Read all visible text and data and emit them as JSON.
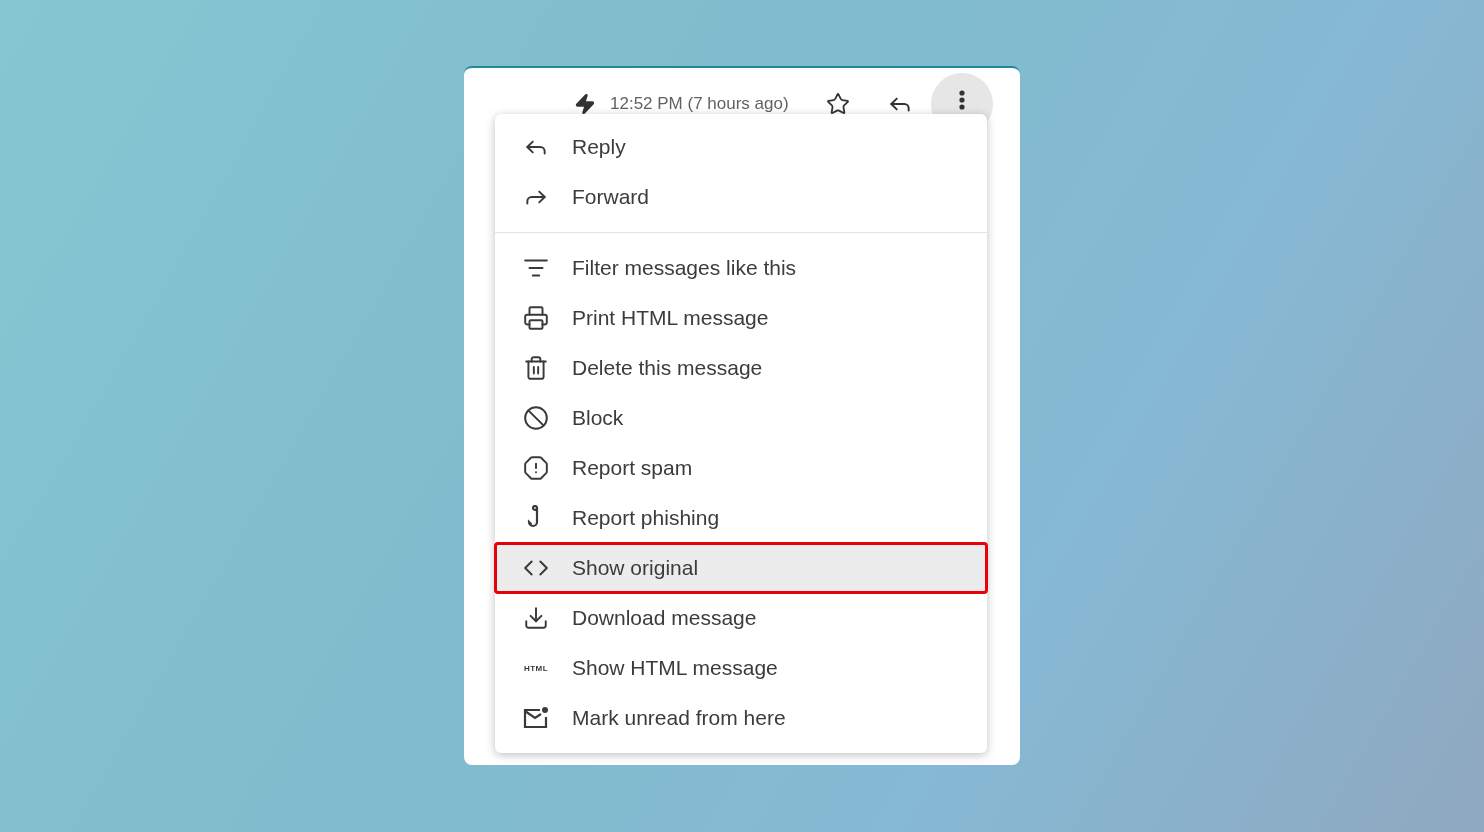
{
  "header": {
    "time": "12:52 PM (7 hours ago)"
  },
  "menu": {
    "sections": [
      {
        "items": [
          {
            "kind": "reply",
            "label": "Reply",
            "selected": false
          },
          {
            "kind": "forward",
            "label": "Forward",
            "selected": false
          }
        ]
      },
      {
        "items": [
          {
            "kind": "filter",
            "label": "Filter messages like this",
            "selected": false
          },
          {
            "kind": "print",
            "label": "Print HTML message",
            "selected": false
          },
          {
            "kind": "delete",
            "label": "Delete this message",
            "selected": false
          },
          {
            "kind": "block",
            "label": "Block",
            "selected": false
          },
          {
            "kind": "spam",
            "label": "Report spam",
            "selected": false
          },
          {
            "kind": "phishing",
            "label": "Report phishing",
            "selected": false
          },
          {
            "kind": "code",
            "label": "Show original",
            "selected": true
          },
          {
            "kind": "download",
            "label": "Download message",
            "selected": false
          },
          {
            "kind": "html",
            "icon_text": "HTML",
            "label": "Show HTML message",
            "selected": false
          },
          {
            "kind": "unread",
            "label": "Mark unread from here",
            "selected": false
          }
        ]
      }
    ]
  }
}
